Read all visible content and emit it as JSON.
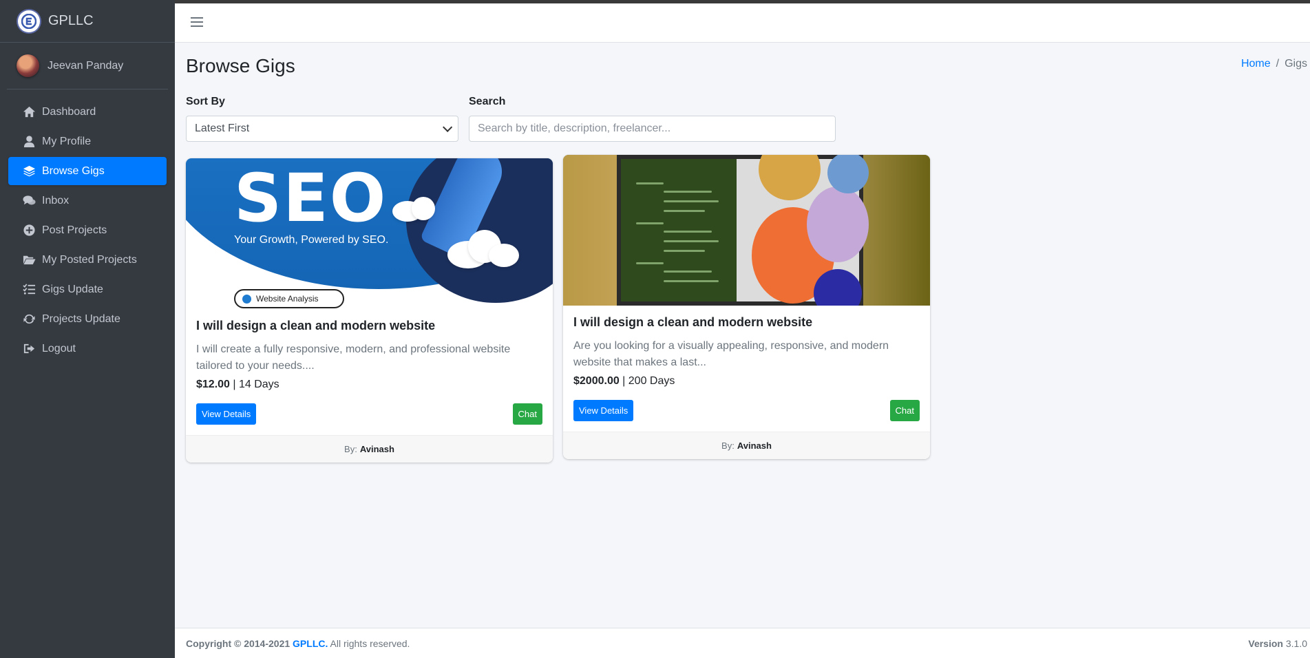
{
  "app": {
    "brand": "GPLLC"
  },
  "user": {
    "name": "Jeevan Panday"
  },
  "sidebar": {
    "items": [
      {
        "label": "Dashboard",
        "icon": "home-icon",
        "active": false
      },
      {
        "label": "My Profile",
        "icon": "user-icon",
        "active": false
      },
      {
        "label": "Browse Gigs",
        "icon": "layers-icon",
        "active": true
      },
      {
        "label": "Inbox",
        "icon": "comments-icon",
        "active": false
      },
      {
        "label": "Post Projects",
        "icon": "plus-circle-icon",
        "active": false
      },
      {
        "label": "My Posted Projects",
        "icon": "folder-open-icon",
        "active": false
      },
      {
        "label": "Gigs Update",
        "icon": "tasks-icon",
        "active": false
      },
      {
        "label": "Projects Update",
        "icon": "sync-icon",
        "active": false
      },
      {
        "label": "Logout",
        "icon": "logout-icon",
        "active": false
      }
    ]
  },
  "page": {
    "title": "Browse Gigs",
    "breadcrumb": {
      "home": "Home",
      "separator": "/",
      "current": "Gigs"
    }
  },
  "filters": {
    "sort_label": "Sort By",
    "sort_value": "Latest First",
    "search_label": "Search",
    "search_placeholder": "Search by title, description, freelancer..."
  },
  "gigs": [
    {
      "title": "I will design a clean and modern website",
      "description": "I will create a fully responsive, modern, and professional website tailored to your needs....",
      "price": "$12.00",
      "duration": "14 Days",
      "view_label": "View Details",
      "chat_label": "Chat",
      "by_label": "By:",
      "author": "Avinash",
      "image": {
        "headline": "SEO",
        "tagline": "Your Growth, Powered by SEO.",
        "badge": "Website Analysis"
      }
    },
    {
      "title": "I will design a clean and modern website",
      "description": "Are you looking for a visually appealing, responsive, and modern website that makes a last...",
      "price": "$2000.00",
      "duration": "200 Days",
      "view_label": "View Details",
      "chat_label": "Chat",
      "by_label": "By:",
      "author": "Avinash"
    }
  ],
  "footer": {
    "copyright": "Copyright © 2014-2021",
    "brand": "GPLLC.",
    "rights": "All rights reserved.",
    "version_label": "Version",
    "version": "3.1.0"
  },
  "colors": {
    "primary": "#007bff",
    "success": "#28a745",
    "sidebar": "#343a40"
  }
}
